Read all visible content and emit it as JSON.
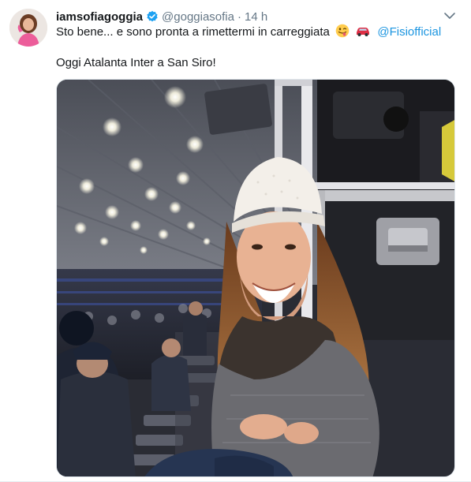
{
  "tweet": {
    "display_name": "iamsofiagoggia",
    "handle": "@goggiasofia",
    "separator": "·",
    "time": "14 h",
    "line1_text": "Sto bene... e sono pronta a rimettermi in carreggiata",
    "mention": "@Fisiofficial",
    "line2_text": "Oggi Atalanta Inter a San Siro!"
  },
  "icons": {
    "verified": "verified-badge-icon",
    "caret": "chevron-down-icon",
    "emoji_1": "winking-face-tongue-emoji",
    "emoji_2": "red-car-emoji"
  },
  "colors": {
    "link": "#1b95e0",
    "secondary_text": "#657786",
    "verified": "#1da1f2"
  }
}
